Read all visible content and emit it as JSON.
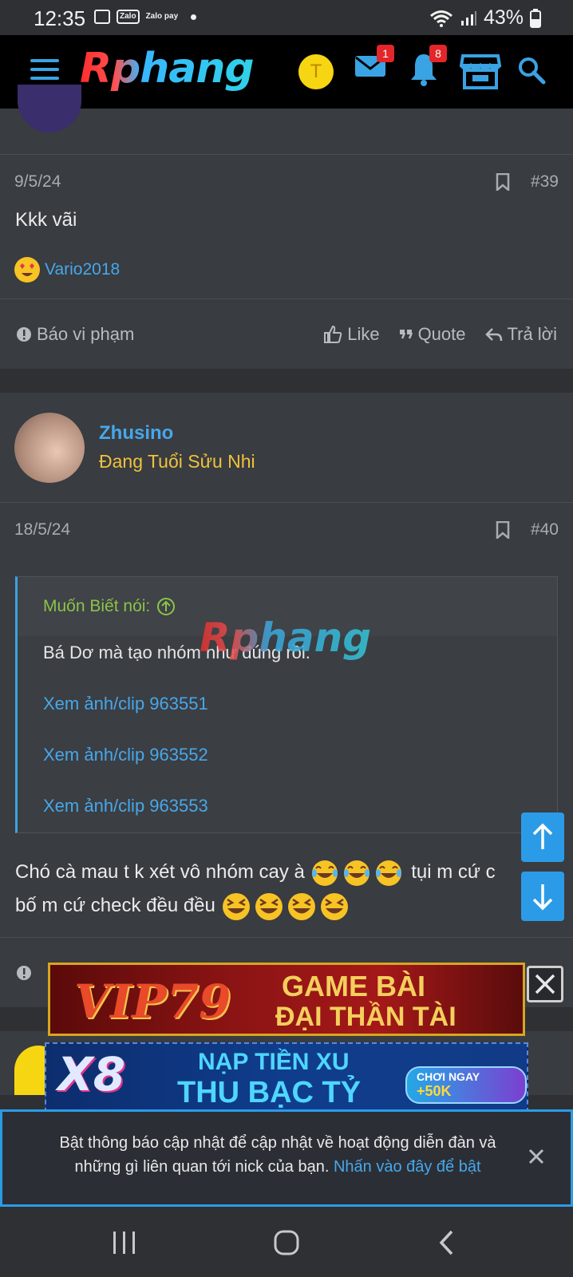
{
  "status_bar": {
    "time": "12:35",
    "battery": "43%",
    "zalo": "Zalo",
    "zalopay": "Zalo pay"
  },
  "header": {
    "logo": "Rphang",
    "avatar_letter": "T",
    "messages_badge": "1",
    "notifications_badge": "8"
  },
  "post39": {
    "date": "9/5/24",
    "number": "#39",
    "body": "Kkk vãi",
    "reaction_user": "Vario2018"
  },
  "actions": {
    "report": "Báo vi phạm",
    "like": "Like",
    "quote": "Quote",
    "reply": "Trả lời"
  },
  "post40": {
    "username": "Zhusino",
    "user_title": "Đang Tuổi Sửu Nhi",
    "date": "18/5/24",
    "number": "#40",
    "quote_author": "Muốn Biết nói:",
    "quote_text": "Bá Dơ mà tạo nhóm như đúng rồi.",
    "quote_links": [
      "Xem ảnh/clip 963551",
      "Xem ảnh/clip 963552",
      "Xem ảnh/clip 963553"
    ],
    "body_line1": "Chó cà mau t k xét vô nhóm cay à",
    "body_line1_tail": "tụi m cứ c",
    "body_line2": "bố m cứ check đều đều"
  },
  "watermark": "Rphang",
  "ads": {
    "ad1_brand": "VIP79",
    "ad1_line1": "GAME BÀI",
    "ad1_line2": "ĐẠI THẦN TÀI",
    "ad2_brand": "X8",
    "ad2_line1": "NẠP TIỀN XU",
    "ad2_line2": "THU BẠC TỶ",
    "ad2_cta_text": "CHƠI NGAY",
    "ad2_cta_bonus": "+50K"
  },
  "notification": {
    "text": "Bật thông báo cập nhật để cập nhật về hoạt động diễn đàn và những gì liên quan tới nick của bạn.",
    "link": "Nhấn vào đây để bật"
  },
  "icons": [
    "menu-icon",
    "mail-icon",
    "bell-icon",
    "store-icon",
    "search-icon",
    "bookmark-icon",
    "alert-icon",
    "thumbs-up-icon",
    "quote-icon",
    "reply-icon",
    "arrow-up-icon",
    "arrow-down-icon",
    "close-icon",
    "recents-icon",
    "home-icon",
    "back-icon"
  ],
  "colors": {
    "accent": "#47a7eb",
    "gold": "#f0c23c",
    "quote_green": "#8bc34a",
    "badge_red": "#e2262a"
  }
}
